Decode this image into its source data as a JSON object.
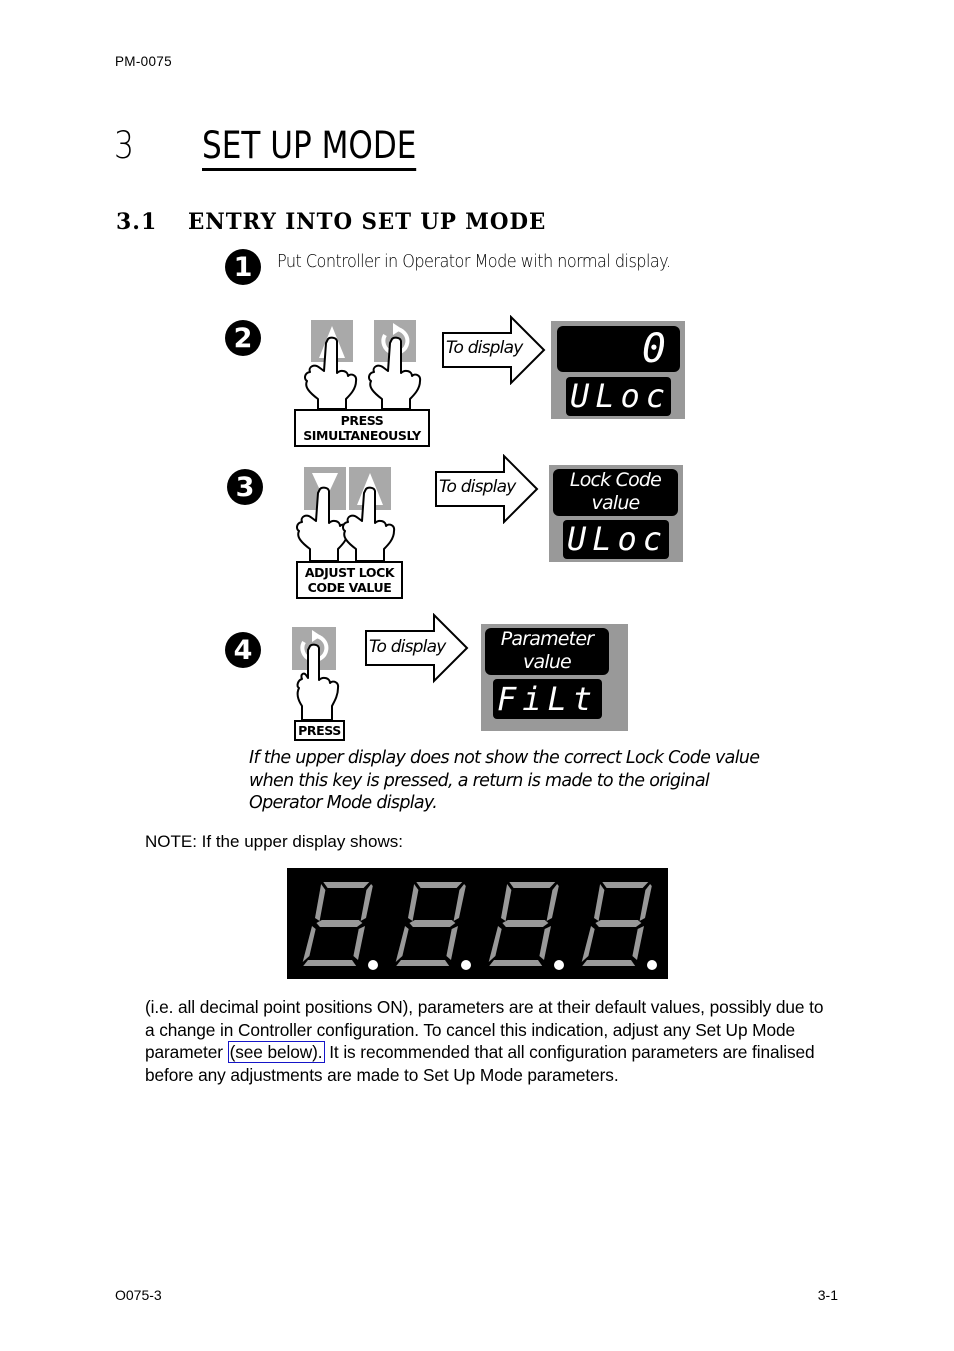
{
  "header": {
    "doc_code": "PM-0075"
  },
  "chapter": {
    "number": "3",
    "title": "SET UP MODE"
  },
  "section": {
    "number": "3.1",
    "title": "ENTRY INTO SET UP MODE"
  },
  "steps": [
    {
      "number": "1",
      "text": "Put Controller in Operator Mode with normal display."
    },
    {
      "number": "2",
      "keys": [
        "up-arrow-key",
        "scroll-key"
      ],
      "label_lines": [
        "PRESS",
        "SIMULTANEOUSLY"
      ],
      "arrow_text": "To display",
      "display_upper": "0",
      "display_lower": "ULoc"
    },
    {
      "number": "3",
      "keys": [
        "down-arrow-key",
        "up-arrow-key"
      ],
      "label_lines": [
        "ADJUST LOCK",
        "CODE VALUE"
      ],
      "arrow_text": "To display",
      "display_upper_lines": [
        "Lock Code",
        "value"
      ],
      "display_lower": "ULoc"
    },
    {
      "number": "4",
      "keys": [
        "scroll-key"
      ],
      "label_lines": [
        "PRESS"
      ],
      "arrow_text": "To display",
      "display_upper_lines": [
        "Parameter",
        "value"
      ],
      "display_lower": "FiLt"
    }
  ],
  "step4_note": "If the upper display does not show the correct Lock Code value when this key is pressed, a return is made to the original Operator Mode display.",
  "note": {
    "intro": "NOTE: If the upper display shows:",
    "display_digits": 4,
    "decimal_points_on": true,
    "segment_color": "#999999",
    "dp_color": "#ffffff",
    "paragraph_before_link": "(i.e. all decimal point positions ON), parameters are at their default values, possibly due to a change in Controller configuration. To cancel this indication, adjust any Set Up Mode parameter ",
    "link_text": "(see below).",
    "paragraph_after_link": " It is recommended that all configuration parameters are finalised before any adjustments are made to Set Up Mode parameters."
  },
  "colors": {
    "key_gray": "#a9a9a9",
    "panel_gray": "#999999",
    "link_border": "#1515c8"
  },
  "footer": {
    "left": "O075-3",
    "right": "3-1"
  }
}
